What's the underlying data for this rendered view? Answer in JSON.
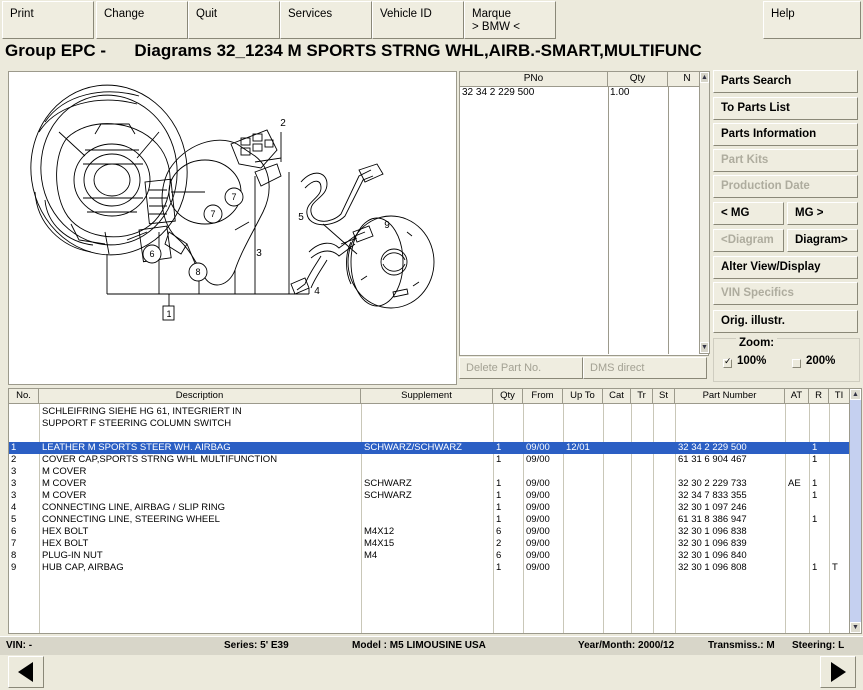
{
  "menu": {
    "items": [
      {
        "label": "Print",
        "sub": ""
      },
      {
        "label": "Change",
        "sub": ""
      },
      {
        "label": "Quit",
        "sub": ""
      },
      {
        "label": "Services",
        "sub": ""
      },
      {
        "label": "Vehicle ID",
        "sub": ""
      },
      {
        "label": "Marque",
        "sub": "> BMW <"
      },
      {
        "label": "Help",
        "sub": ""
      }
    ]
  },
  "title": "Group EPC -      Diagrams 32_1234 M SPORTS STRNG WHL,AIRB.-SMART,MULTIFUNC",
  "diagram": {
    "id": "00080434",
    "callouts": [
      "1",
      "2",
      "3",
      "4",
      "5",
      "6",
      "7",
      "7",
      "8",
      "9"
    ],
    "legend": [
      {
        "nums": "6\n7",
        "icon": "screw-icon"
      },
      {
        "nums": "8",
        "icon": "nut-icon"
      }
    ]
  },
  "parts_picked": {
    "columns": [
      "PNo",
      "Qty",
      "N"
    ],
    "rows": [
      {
        "pno": "32 34 2 229 500",
        "qty": "1.00",
        "n": ""
      }
    ],
    "delete_label": "Delete Part No.",
    "dms_label": "DMS direct"
  },
  "right_buttons": [
    {
      "label": "Parts Search",
      "enabled": true
    },
    {
      "label": "To Parts List",
      "enabled": true
    },
    {
      "label": "Parts Information",
      "enabled": true
    },
    {
      "label": "Part Kits",
      "enabled": false
    },
    {
      "label": "Production Date",
      "enabled": false
    },
    {
      "label": "< MG",
      "enabled": true,
      "half": "left"
    },
    {
      "label": "MG >",
      "enabled": true,
      "half": "right"
    },
    {
      "label": "<Diagram",
      "enabled": false,
      "half": "left"
    },
    {
      "label": "Diagram>",
      "enabled": true,
      "half": "right"
    },
    {
      "label": "Alter View/Display",
      "enabled": true
    },
    {
      "label": "VIN Specifics",
      "enabled": false
    },
    {
      "label": "Orig. illustr.",
      "enabled": true
    }
  ],
  "zoom": {
    "label": "Zoom:",
    "option_100": "100%",
    "option_200": "200%",
    "checked_100": true,
    "checked_200": false
  },
  "table": {
    "columns": [
      "No.",
      "Description",
      "Supplement",
      "Qty",
      "From",
      "Up To",
      "Cat",
      "Tr",
      "St",
      "Part Number",
      "AT",
      "R",
      "TI"
    ],
    "rows": [
      {
        "no": "",
        "desc": "SCHLEIFRING SIEHE HG 61, INTEGRIERT IN",
        "supp": "",
        "qty": "",
        "from": "",
        "upto": "",
        "cat": "",
        "tr": "",
        "st": "",
        "pn": "",
        "at": "",
        "r": "",
        "ti": "",
        "selected": false
      },
      {
        "no": "",
        "desc": "SUPPORT F STEERING COLUMN SWITCH",
        "supp": "",
        "qty": "",
        "from": "",
        "upto": "",
        "cat": "",
        "tr": "",
        "st": "",
        "pn": "",
        "at": "",
        "r": "",
        "ti": "",
        "selected": false
      },
      {
        "no": "",
        "desc": "",
        "supp": "",
        "qty": "",
        "from": "",
        "upto": "",
        "cat": "",
        "tr": "",
        "st": "",
        "pn": "",
        "at": "",
        "r": "",
        "ti": "",
        "selected": false
      },
      {
        "no": "1",
        "desc": "LEATHER M SPORTS STEER WH. AIRBAG",
        "supp": "SCHWARZ/SCHWARZ",
        "qty": "1",
        "from": "09/00",
        "upto": "12/01",
        "cat": "",
        "tr": "",
        "st": "",
        "pn": "32 34 2 229 500",
        "at": "",
        "r": "1",
        "ti": "",
        "selected": true
      },
      {
        "no": "2",
        "desc": "COVER CAP,SPORTS STRNG WHL MULTIFUNCTION",
        "supp": "",
        "qty": "1",
        "from": "09/00",
        "upto": "",
        "cat": "",
        "tr": "",
        "st": "",
        "pn": "61 31 6 904 467",
        "at": "",
        "r": "1",
        "ti": "",
        "selected": false
      },
      {
        "no": "3",
        "desc": "M COVER",
        "supp": "",
        "qty": "",
        "from": "",
        "upto": "",
        "cat": "",
        "tr": "",
        "st": "",
        "pn": "",
        "at": "",
        "r": "",
        "ti": "",
        "selected": false
      },
      {
        "no": "3",
        "desc": "M COVER",
        "supp": "SCHWARZ",
        "qty": "1",
        "from": "09/00",
        "upto": "",
        "cat": "",
        "tr": "",
        "st": "",
        "pn": "32 30 2 229 733",
        "at": "AE",
        "r": "1",
        "ti": "",
        "selected": false
      },
      {
        "no": "3",
        "desc": "M COVER",
        "supp": "SCHWARZ",
        "qty": "1",
        "from": "09/00",
        "upto": "",
        "cat": "",
        "tr": "",
        "st": "",
        "pn": "32 34 7 833 355",
        "at": "",
        "r": "1",
        "ti": "",
        "selected": false
      },
      {
        "no": "4",
        "desc": "CONNECTING LINE, AIRBAG / SLIP RING",
        "supp": "",
        "qty": "1",
        "from": "09/00",
        "upto": "",
        "cat": "",
        "tr": "",
        "st": "",
        "pn": "32 30 1 097 246",
        "at": "",
        "r": "",
        "ti": "",
        "selected": false
      },
      {
        "no": "5",
        "desc": "CONNECTING LINE, STEERING WHEEL",
        "supp": "",
        "qty": "1",
        "from": "09/00",
        "upto": "",
        "cat": "",
        "tr": "",
        "st": "",
        "pn": "61 31 8 386 947",
        "at": "",
        "r": "1",
        "ti": "",
        "selected": false
      },
      {
        "no": "6",
        "desc": "HEX BOLT",
        "supp": "M4X12",
        "qty": "6",
        "from": "09/00",
        "upto": "",
        "cat": "",
        "tr": "",
        "st": "",
        "pn": "32 30 1 096 838",
        "at": "",
        "r": "",
        "ti": "",
        "selected": false
      },
      {
        "no": "7",
        "desc": "HEX BOLT",
        "supp": "M4X15",
        "qty": "2",
        "from": "09/00",
        "upto": "",
        "cat": "",
        "tr": "",
        "st": "",
        "pn": "32 30 1 096 839",
        "at": "",
        "r": "",
        "ti": "",
        "selected": false
      },
      {
        "no": "8",
        "desc": "PLUG-IN NUT",
        "supp": "M4",
        "qty": "6",
        "from": "09/00",
        "upto": "",
        "cat": "",
        "tr": "",
        "st": "",
        "pn": "32 30 1 096 840",
        "at": "",
        "r": "",
        "ti": "",
        "selected": false
      },
      {
        "no": "9",
        "desc": "HUB CAP, AIRBAG",
        "supp": "",
        "qty": "1",
        "from": "09/00",
        "upto": "",
        "cat": "",
        "tr": "",
        "st": "",
        "pn": "32 30 1 096 808",
        "at": "",
        "r": "1",
        "ti": "T",
        "selected": false
      }
    ]
  },
  "status": {
    "vin": "VIN: -",
    "series": "Series: 5' E39",
    "model": "Model : M5 LIMOUSINE USA",
    "yearmonth": "Year/Month: 2000/12",
    "transmission": "Transmiss.: M",
    "steering": "Steering: L"
  },
  "nav": {
    "prev": "previous-arrow",
    "next": "next-arrow"
  },
  "colors": {
    "selection": "#2B5FC4",
    "background": "#ECEADC",
    "panel": "#EFEDE0"
  }
}
